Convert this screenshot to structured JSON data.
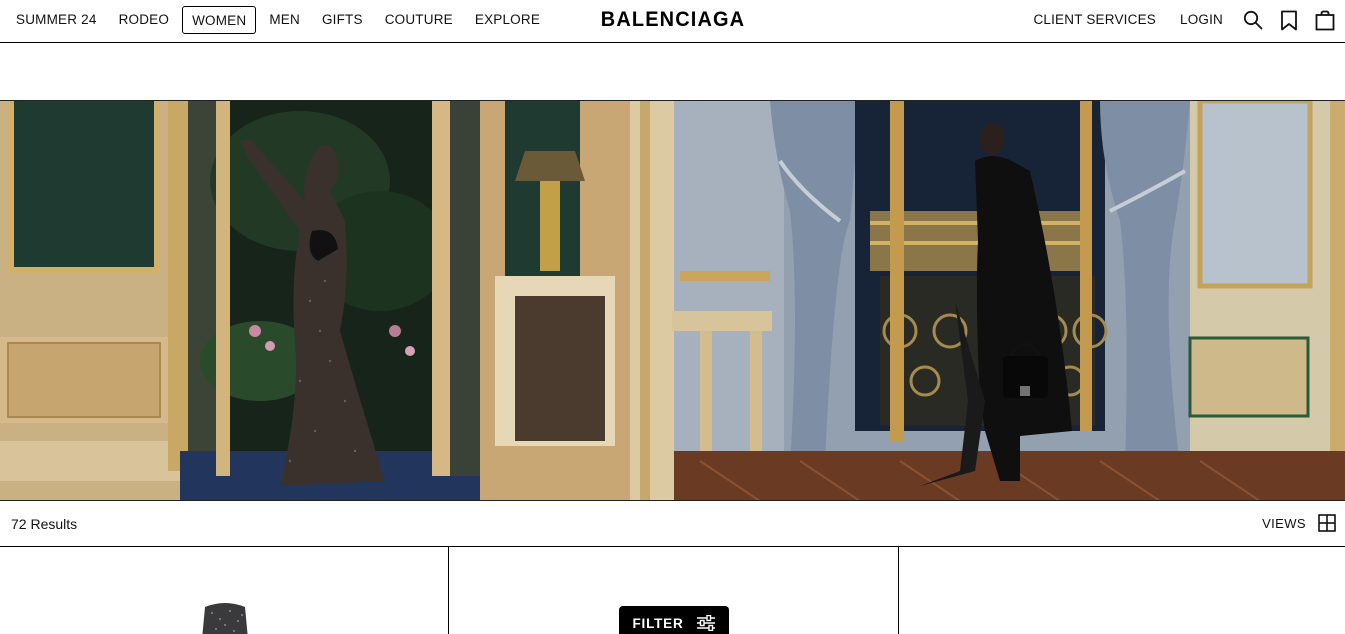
{
  "header": {
    "brand": "BALENCIAGA",
    "nav_left": [
      {
        "label": "SUMMER 24"
      },
      {
        "label": "RODEO"
      },
      {
        "label": "WOMEN",
        "active": true
      },
      {
        "label": "MEN"
      },
      {
        "label": "GIFTS"
      },
      {
        "label": "COUTURE"
      },
      {
        "label": "EXPLORE"
      }
    ],
    "nav_right": {
      "client_services": "CLIENT SERVICES",
      "login": "LOGIN"
    },
    "icons": [
      "search-icon",
      "bookmark-icon",
      "shopping-bag-icon"
    ]
  },
  "results": {
    "count_label": "72 Results",
    "views_label": "VIEWS"
  },
  "filter": {
    "label": "FILTER"
  },
  "colors": {
    "text": "#111111",
    "border": "#000000",
    "filter_bg": "#000000",
    "filter_text": "#ffffff"
  }
}
